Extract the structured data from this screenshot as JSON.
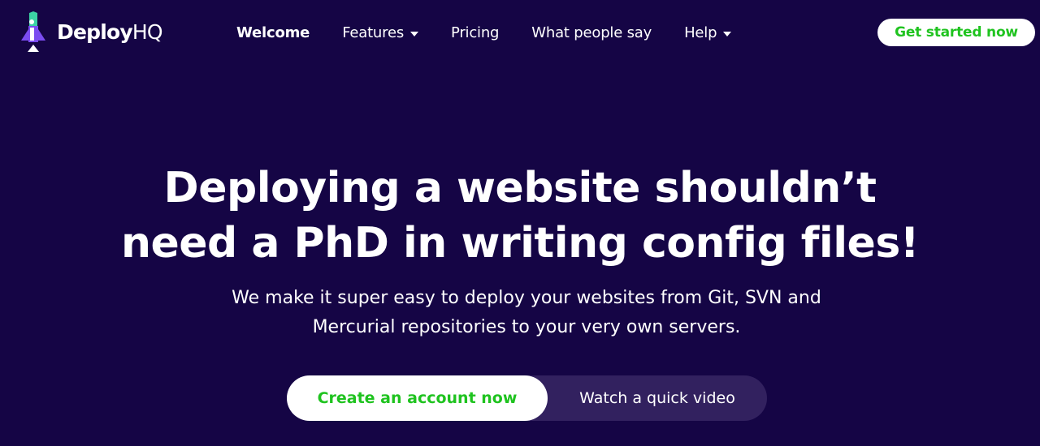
{
  "brand": {
    "name_bold": "Deploy",
    "name_light": "HQ",
    "icon": "rocket-logo-icon",
    "colors": {
      "background": "#150545",
      "accent_green": "#1fc31f",
      "logo_teal": "#3cd2a5",
      "logo_purple": "#7b4cf0"
    }
  },
  "nav": {
    "items": [
      {
        "label": "Welcome",
        "active": true,
        "dropdown": false
      },
      {
        "label": "Features",
        "active": false,
        "dropdown": true
      },
      {
        "label": "Pricing",
        "active": false,
        "dropdown": false
      },
      {
        "label": "What people say",
        "active": false,
        "dropdown": false
      },
      {
        "label": "Help",
        "active": false,
        "dropdown": true
      }
    ],
    "cta_label": "Get started now"
  },
  "hero": {
    "title_line1": "Deploying a website shouldn’t",
    "title_line2": "need a PhD in writing config files!",
    "subtitle_line1": "We make it super easy to deploy your websites from Git, SVN and",
    "subtitle_line2": "Mercurial repositories to your very own servers.",
    "primary_cta": "Create an account now",
    "secondary_cta": "Watch a quick video"
  }
}
